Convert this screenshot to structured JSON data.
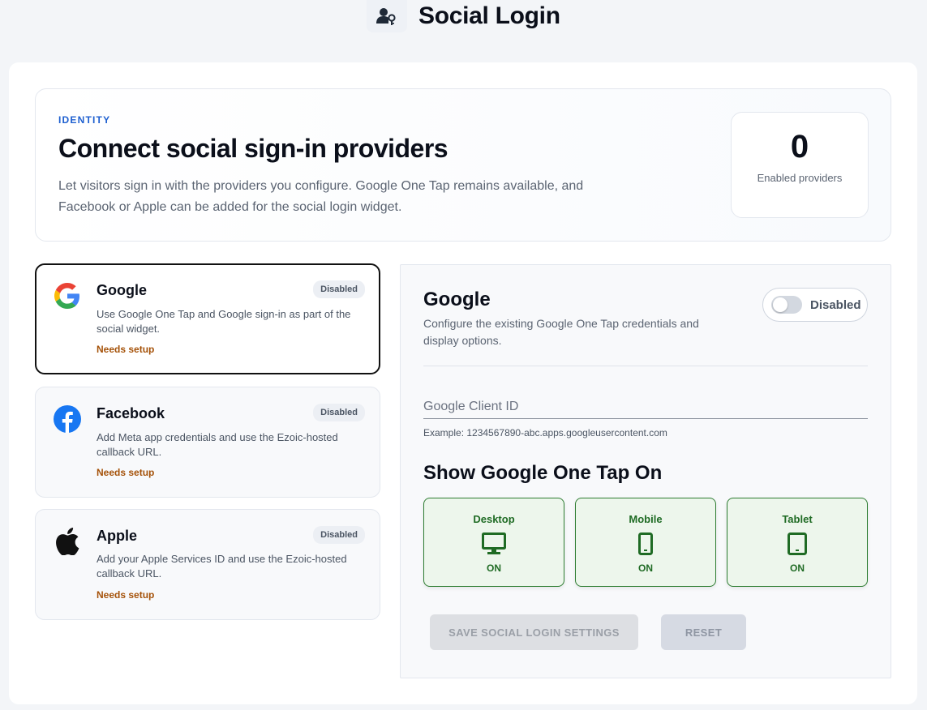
{
  "header": {
    "title": "Social Login",
    "icon": "user-key-icon"
  },
  "hero": {
    "eyebrow": "IDENTITY",
    "title": "Connect social sign-in providers",
    "description": "Let visitors sign in with the providers you configure. Google One Tap remains available, and Facebook or Apple can be added for the social login widget.",
    "count": "0",
    "count_label": "Enabled providers"
  },
  "providers": [
    {
      "name": "Google",
      "badge": "Disabled",
      "description": "Use Google One Tap and Google sign-in as part of the social widget.",
      "status": "Needs setup",
      "icon": "google-icon"
    },
    {
      "name": "Facebook",
      "badge": "Disabled",
      "description": "Add Meta app credentials and use the Ezoic-hosted callback URL.",
      "status": "Needs setup",
      "icon": "facebook-icon"
    },
    {
      "name": "Apple",
      "badge": "Disabled",
      "description": "Add your Apple Services ID and use the Ezoic-hosted callback URL.",
      "status": "Needs setup",
      "icon": "apple-icon"
    }
  ],
  "detail": {
    "title": "Google",
    "description": "Configure the existing Google One Tap credentials and display options.",
    "toggle_label": "Disabled",
    "client_id_placeholder": "Google Client ID",
    "client_id_value": "",
    "client_id_hint": "Example: 1234567890-abc.apps.googleusercontent.com",
    "section_title": "Show Google One Tap On",
    "devices": [
      {
        "name": "Desktop",
        "state": "ON",
        "icon": "desktop-icon"
      },
      {
        "name": "Mobile",
        "state": "ON",
        "icon": "mobile-icon"
      },
      {
        "name": "Tablet",
        "state": "ON",
        "icon": "tablet-icon"
      }
    ],
    "save_label": "SAVE SOCIAL LOGIN SETTINGS",
    "reset_label": "RESET"
  },
  "colors": {
    "accent": "#1d5fd0",
    "device_on": "#2e7d32",
    "needs_setup": "#a55209"
  }
}
